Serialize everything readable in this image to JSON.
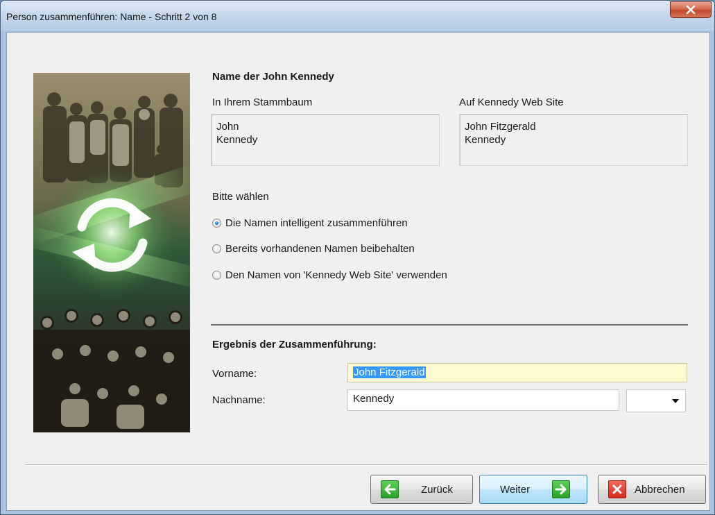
{
  "window": {
    "title": "Person zusammenführen: Name - Schritt 2 von 8"
  },
  "side_image": {
    "description_icon": "sync-arrows-icon"
  },
  "section_name": {
    "heading": "Name der John Kennedy",
    "left_label": "In Ihrem Stammbaum",
    "left_lines": [
      "John",
      "Kennedy"
    ],
    "right_label": "Auf Kennedy Web Site",
    "right_lines": [
      "John Fitzgerald",
      "Kennedy"
    ]
  },
  "choice": {
    "prompt": "Bitte wählen",
    "options": [
      {
        "label": "Die Namen intelligent zusammenführen",
        "checked": true
      },
      {
        "label": "Bereits vorhandenen Namen beibehalten",
        "checked": false
      },
      {
        "label": "Den Namen von 'Kennedy Web Site' verwenden",
        "checked": false
      }
    ]
  },
  "result": {
    "heading": "Ergebnis der Zusammenführung:",
    "first_name_label": "Vorname:",
    "first_name_value": "John Fitzgerald",
    "last_name_label": "Nachname:",
    "last_name_value": "Kennedy",
    "suffix_value": ""
  },
  "buttons": {
    "back": "Zurück",
    "next": "Weiter",
    "cancel": "Abbrechen"
  },
  "colors": {
    "focused_field": "#fffbd0",
    "selection": "#3399ff",
    "next_accent": "#2aa02a",
    "cancel_accent": "#d62a1e"
  }
}
